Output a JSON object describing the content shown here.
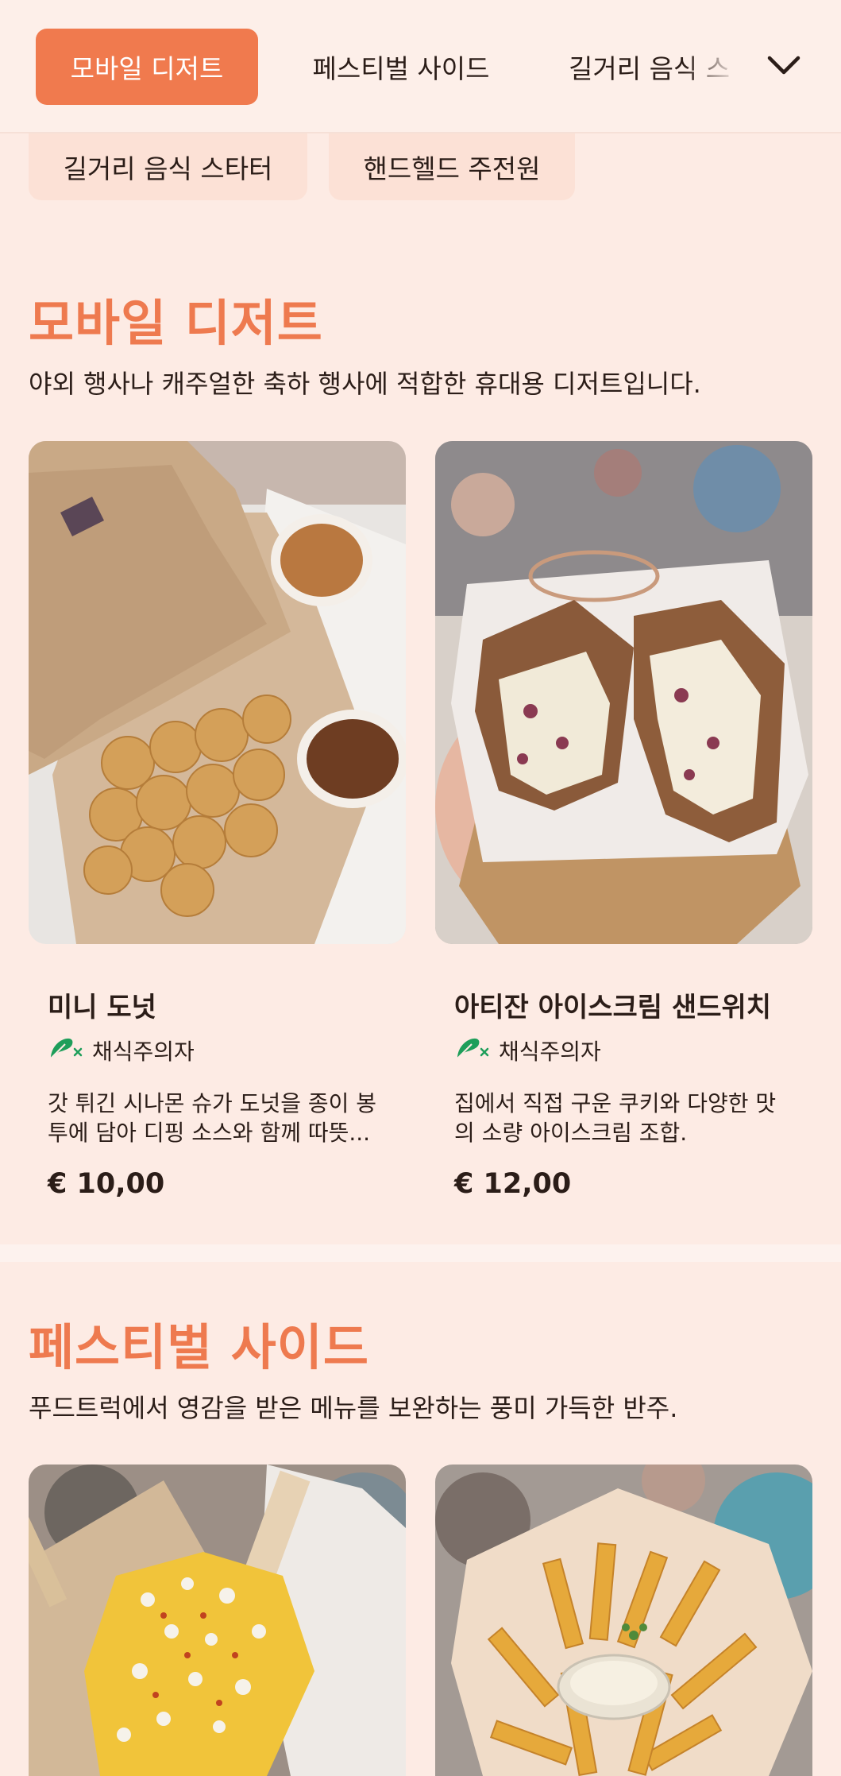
{
  "tabs": [
    {
      "label": "모바일 디저트",
      "active": true
    },
    {
      "label": "페스티벌 사이드",
      "active": false
    },
    {
      "label": "길거리 음식 스",
      "active": false
    }
  ],
  "chips": [
    {
      "label": "길거리 음식 스타터"
    },
    {
      "label": "핸드헬드 주전원"
    }
  ],
  "sections": [
    {
      "title": "모바일 디저트",
      "description": "야외 행사나 캐주얼한 축하 행사에 적합한 휴대용 디저트입니다.",
      "items": [
        {
          "name": "미니 도넛",
          "diet": "채식주의자",
          "description_line1": "갓 튀긴 시나몬 슈가 도넛을 종이 봉",
          "description_line2": "투에 담아 디핑 소스와 함께 따뜻...",
          "price": "€ 10,00",
          "image_icon": "mini-donuts-photo"
        },
        {
          "name": "아티잔 아이스크림 샌드위치",
          "diet": "채식주의자",
          "description_line1": "집에서 직접 구운 쿠키와 다양한 맛",
          "description_line2": "의 소량 아이스크림 조합.",
          "price": "€ 12,00",
          "image_icon": "ice-cream-sandwich-photo"
        }
      ]
    },
    {
      "title": "페스티벌 사이드",
      "description": "푸드트럭에서 영감을 받은 메뉴를 보완하는 풍미 가득한 반주.",
      "items": [
        {
          "image_icon": "street-corn-photo"
        },
        {
          "image_icon": "loaded-fries-photo"
        }
      ]
    }
  ],
  "colors": {
    "accent": "#f07a4e",
    "background": "#fdebe4",
    "veg_icon": "#1e9e5a"
  }
}
